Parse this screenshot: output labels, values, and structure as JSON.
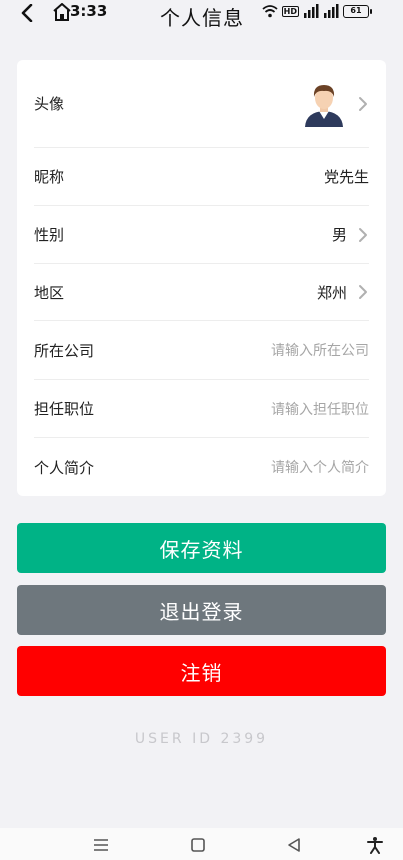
{
  "status_bar": {
    "time": "3:33",
    "battery": "61",
    "hd_badge": "HD"
  },
  "header": {
    "title": "个人信息"
  },
  "profile": {
    "rows": [
      {
        "label": "头像",
        "value": "",
        "type": "avatar"
      },
      {
        "label": "昵称",
        "value": "党先生"
      },
      {
        "label": "性别",
        "value": "男"
      },
      {
        "label": "地区",
        "value": "郑州"
      },
      {
        "label": "所在公司",
        "placeholder": "请输入所在公司"
      },
      {
        "label": "担任职位",
        "placeholder": "请输入担任职位"
      },
      {
        "label": "个人简介",
        "placeholder": "请输入个人简介"
      }
    ]
  },
  "actions": {
    "save": "保存资料",
    "logout": "退出登录",
    "cancel": "注销"
  },
  "footer": {
    "user_id": "USER ID 2399"
  },
  "colors": {
    "save": "#00b386",
    "logout": "#6e777d",
    "cancel": "#ff0000",
    "background": "#f2f2f5"
  },
  "icons": {
    "back": "chevron-left-icon",
    "chevron": "chevron-right-icon",
    "nav_menu": "menu-icon",
    "nav_home": "square-icon",
    "nav_back": "triangle-back-icon",
    "nav_accessibility": "accessibility-icon"
  }
}
